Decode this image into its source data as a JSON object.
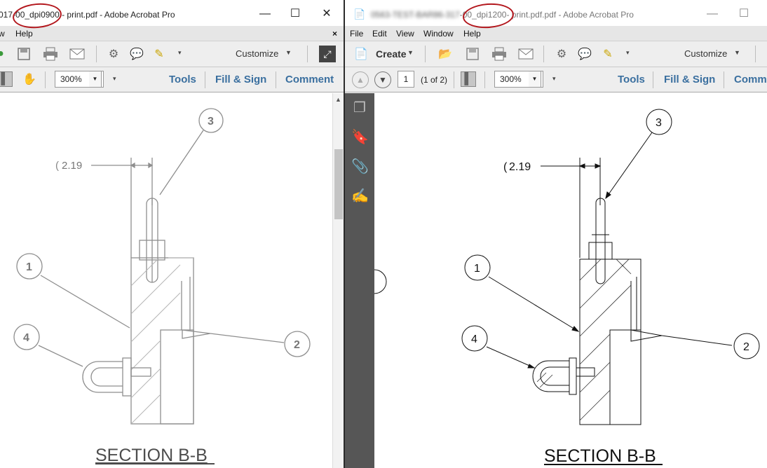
{
  "left": {
    "title_prefix": "017-00",
    "title_dpi": "_dpi0900 -",
    "title_suffix": " print.pdf - Adobe Acrobat Pro",
    "menu": [
      "w",
      "Help"
    ],
    "menu_close": "×",
    "toolbar_customize": "Customize",
    "zoom": "300%",
    "links": [
      "Tools",
      "Fill & Sign",
      "Comment"
    ],
    "drawing": {
      "dim": "2.19",
      "balloons": [
        "3",
        "1",
        "4",
        "2"
      ],
      "caption": "SECTION B-B"
    }
  },
  "right": {
    "title_blurred": "0563-TEST-BAR86-317",
    "title_dpi": "-00_dpi1200-",
    "title_suffix": " print.pdf.pdf - Adobe Acrobat Pro",
    "menu": [
      "File",
      "Edit",
      "View",
      "Window",
      "Help"
    ],
    "create_label": "Create",
    "toolbar_customize": "Customize",
    "page_number": "1",
    "page_of": "(1 of 2)",
    "zoom": "300%",
    "links": [
      "Tools",
      "Fill & Sign",
      "Comm"
    ],
    "drawing": {
      "dim": "2.19",
      "balloons": [
        "3",
        "1",
        "4",
        "2"
      ],
      "caption": "SECTION B-B"
    }
  },
  "icons": [
    "minimize-icon",
    "maximize-icon",
    "close-icon",
    "save-icon",
    "print-icon",
    "email-icon",
    "gear-icon",
    "comment-bubble-icon",
    "sign-icon",
    "expand-icon",
    "select-cursor-icon",
    "hand-icon",
    "page-up-icon",
    "page-down-icon",
    "pages-icon",
    "bookmark-icon",
    "attachment-icon",
    "signature-icon"
  ],
  "colors": {
    "link": "#3a6f9f",
    "annotation": "#b3171d",
    "nav_panel": "#565656"
  }
}
